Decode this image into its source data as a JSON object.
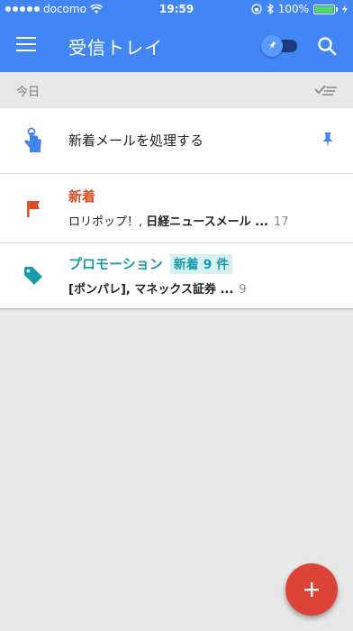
{
  "status_bar": {
    "carrier": "docomo",
    "time": "19:59",
    "battery": "100%"
  },
  "app_bar": {
    "title": "受信トレイ"
  },
  "section": {
    "label": "今日"
  },
  "items": [
    {
      "icon": "hand-pointing-icon",
      "title": "新着メールを処理する",
      "pinned": true
    },
    {
      "icon": "flag-icon",
      "title": "新着",
      "subtitle_plain": "ロリポップ！, ",
      "subtitle_bold": "日経ニュースメール ...",
      "count": "17"
    },
    {
      "icon": "tag-icon",
      "title": "プロモーション",
      "badge": "新着 9 件",
      "subtitle_bold": "[ポンパレ], マネックス証券 ...",
      "count": "9"
    }
  ],
  "colors": {
    "primary": "#4285f4",
    "fab": "#db4437",
    "flag": "#dd4b23",
    "promo": "#1a9bab"
  }
}
